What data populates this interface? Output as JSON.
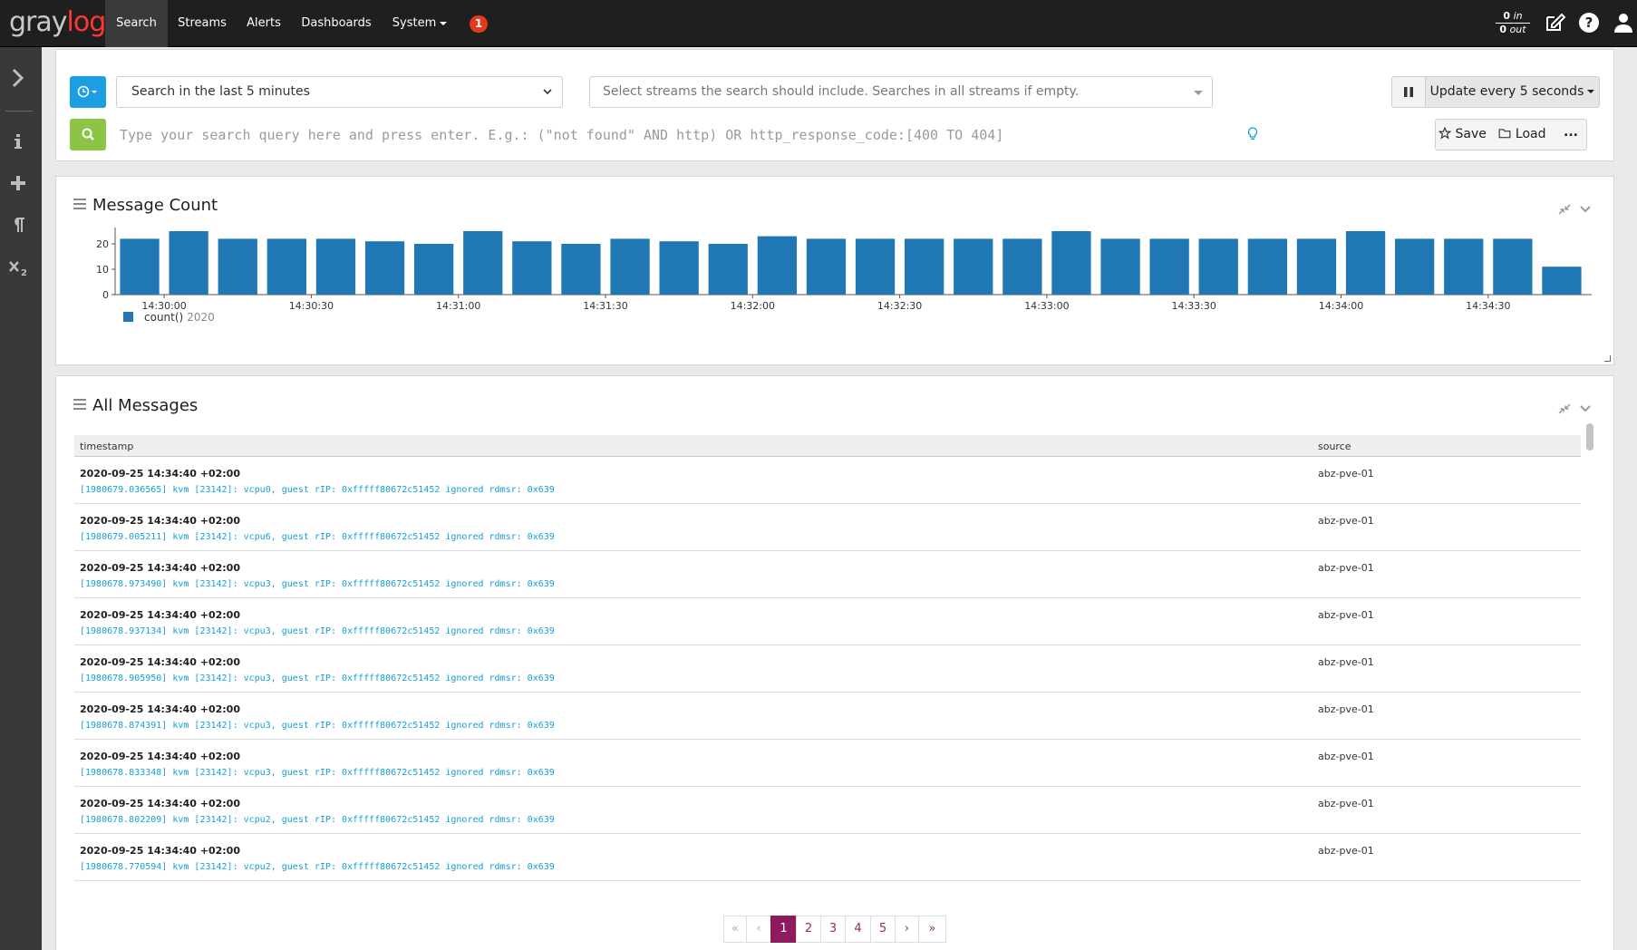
{
  "nav": {
    "items": [
      "Search",
      "Streams",
      "Alerts",
      "Dashboards",
      "System"
    ],
    "notification_count": "1",
    "throughput_in": "0",
    "throughput_in_label": "in",
    "throughput_out": "0",
    "throughput_out_label": "out"
  },
  "search": {
    "timerange": "Search in the last 5 minutes",
    "streams_placeholder": "Select streams the search should include. Searches in all streams if empty.",
    "refresh_label": "Update every 5 seconds",
    "query_placeholder": "Type your search query here and press enter. E.g.: (\"not found\" AND http) OR http_response_code:[400 TO 404]",
    "save_label": "Save",
    "load_label": "Load",
    "more_label": "..."
  },
  "message_count": {
    "title": "Message Count",
    "legend_label": "count()",
    "legend_total": "2020"
  },
  "chart_data": {
    "type": "bar",
    "title": "Message Count",
    "x": [
      "14:29:55",
      "14:30:05",
      "14:30:15",
      "14:30:25",
      "14:30:35",
      "14:30:45",
      "14:30:55",
      "14:31:05",
      "14:31:15",
      "14:31:25",
      "14:31:35",
      "14:31:45",
      "14:31:55",
      "14:32:05",
      "14:32:15",
      "14:32:25",
      "14:32:35",
      "14:32:45",
      "14:32:55",
      "14:33:05",
      "14:33:15",
      "14:33:25",
      "14:33:35",
      "14:33:45",
      "14:33:55",
      "14:34:05",
      "14:34:15",
      "14:34:25",
      "14:34:35",
      "14:34:45"
    ],
    "x_display": [
      "14:30:00",
      "14:30:30",
      "14:31:00",
      "14:31:30",
      "14:32:00",
      "14:32:30",
      "14:33:00",
      "14:33:30",
      "14:34:00",
      "14:34:30"
    ],
    "series": [
      {
        "name": "count()",
        "values": [
          22,
          25,
          22,
          22,
          22,
          21,
          20,
          25,
          21,
          20,
          22,
          21,
          20,
          23,
          22,
          22,
          22,
          22,
          22,
          25,
          22,
          22,
          22,
          22,
          22,
          25,
          22,
          22,
          22,
          11
        ]
      }
    ],
    "y_ticks": [
      0,
      10,
      20
    ],
    "ylim": [
      0,
      25
    ],
    "color": "#1f77b4",
    "grid": false,
    "legend": "bottom-left"
  },
  "messages": {
    "title": "All Messages",
    "columns": [
      "timestamp",
      "source"
    ],
    "rows": [
      {
        "timestamp": "2020-09-25 14:34:40 +02:00",
        "message": "[1980679.036565] kvm [23142]: vcpu0, guest rIP: 0xfffff80672c51452 ignored rdmsr: 0x639",
        "source": "abz-pve-01"
      },
      {
        "timestamp": "2020-09-25 14:34:40 +02:00",
        "message": "[1980679.005211] kvm [23142]: vcpu6, guest rIP: 0xfffff80672c51452 ignored rdmsr: 0x639",
        "source": "abz-pve-01"
      },
      {
        "timestamp": "2020-09-25 14:34:40 +02:00",
        "message": "[1980678.973490] kvm [23142]: vcpu3, guest rIP: 0xfffff80672c51452 ignored rdmsr: 0x639",
        "source": "abz-pve-01"
      },
      {
        "timestamp": "2020-09-25 14:34:40 +02:00",
        "message": "[1980678.937134] kvm [23142]: vcpu3, guest rIP: 0xfffff80672c51452 ignored rdmsr: 0x639",
        "source": "abz-pve-01"
      },
      {
        "timestamp": "2020-09-25 14:34:40 +02:00",
        "message": "[1980678.905950] kvm [23142]: vcpu3, guest rIP: 0xfffff80672c51452 ignored rdmsr: 0x639",
        "source": "abz-pve-01"
      },
      {
        "timestamp": "2020-09-25 14:34:40 +02:00",
        "message": "[1980678.874391] kvm [23142]: vcpu3, guest rIP: 0xfffff80672c51452 ignored rdmsr: 0x639",
        "source": "abz-pve-01"
      },
      {
        "timestamp": "2020-09-25 14:34:40 +02:00",
        "message": "[1980678.833348] kvm [23142]: vcpu3, guest rIP: 0xfffff80672c51452 ignored rdmsr: 0x639",
        "source": "abz-pve-01"
      },
      {
        "timestamp": "2020-09-25 14:34:40 +02:00",
        "message": "[1980678.802209] kvm [23142]: vcpu2, guest rIP: 0xfffff80672c51452 ignored rdmsr: 0x639",
        "source": "abz-pve-01"
      },
      {
        "timestamp": "2020-09-25 14:34:40 +02:00",
        "message": "[1980678.770594] kvm [23142]: vcpu2, guest rIP: 0xfffff80672c51452 ignored rdmsr: 0x639",
        "source": "abz-pve-01"
      }
    ]
  },
  "pagination": {
    "first": "«",
    "prev": "‹",
    "pages": [
      "1",
      "2",
      "3",
      "4",
      "5"
    ],
    "current": "1",
    "next": "›",
    "last": "»"
  },
  "colors": {
    "nav_bg": "#1f1f1f",
    "brand_red": "#ff3633",
    "accent_blue": "#1b9ee2",
    "search_green": "#8cc445",
    "bar_blue": "#1f77b4",
    "link_blue": "#16a0d6",
    "pager_active": "#8f1a5d",
    "badge_red": "#e33a1d"
  },
  "icons": [
    "clock-icon",
    "search-icon",
    "pause-icon",
    "lightbulb-icon",
    "star-icon",
    "folder-icon",
    "edit-icon",
    "help-icon",
    "user-icon",
    "chevron-right-icon",
    "info-icon",
    "plus-icon",
    "paragraph-icon",
    "subscript-icon",
    "hamburger-icon",
    "compress-icon",
    "chevron-down-icon"
  ]
}
